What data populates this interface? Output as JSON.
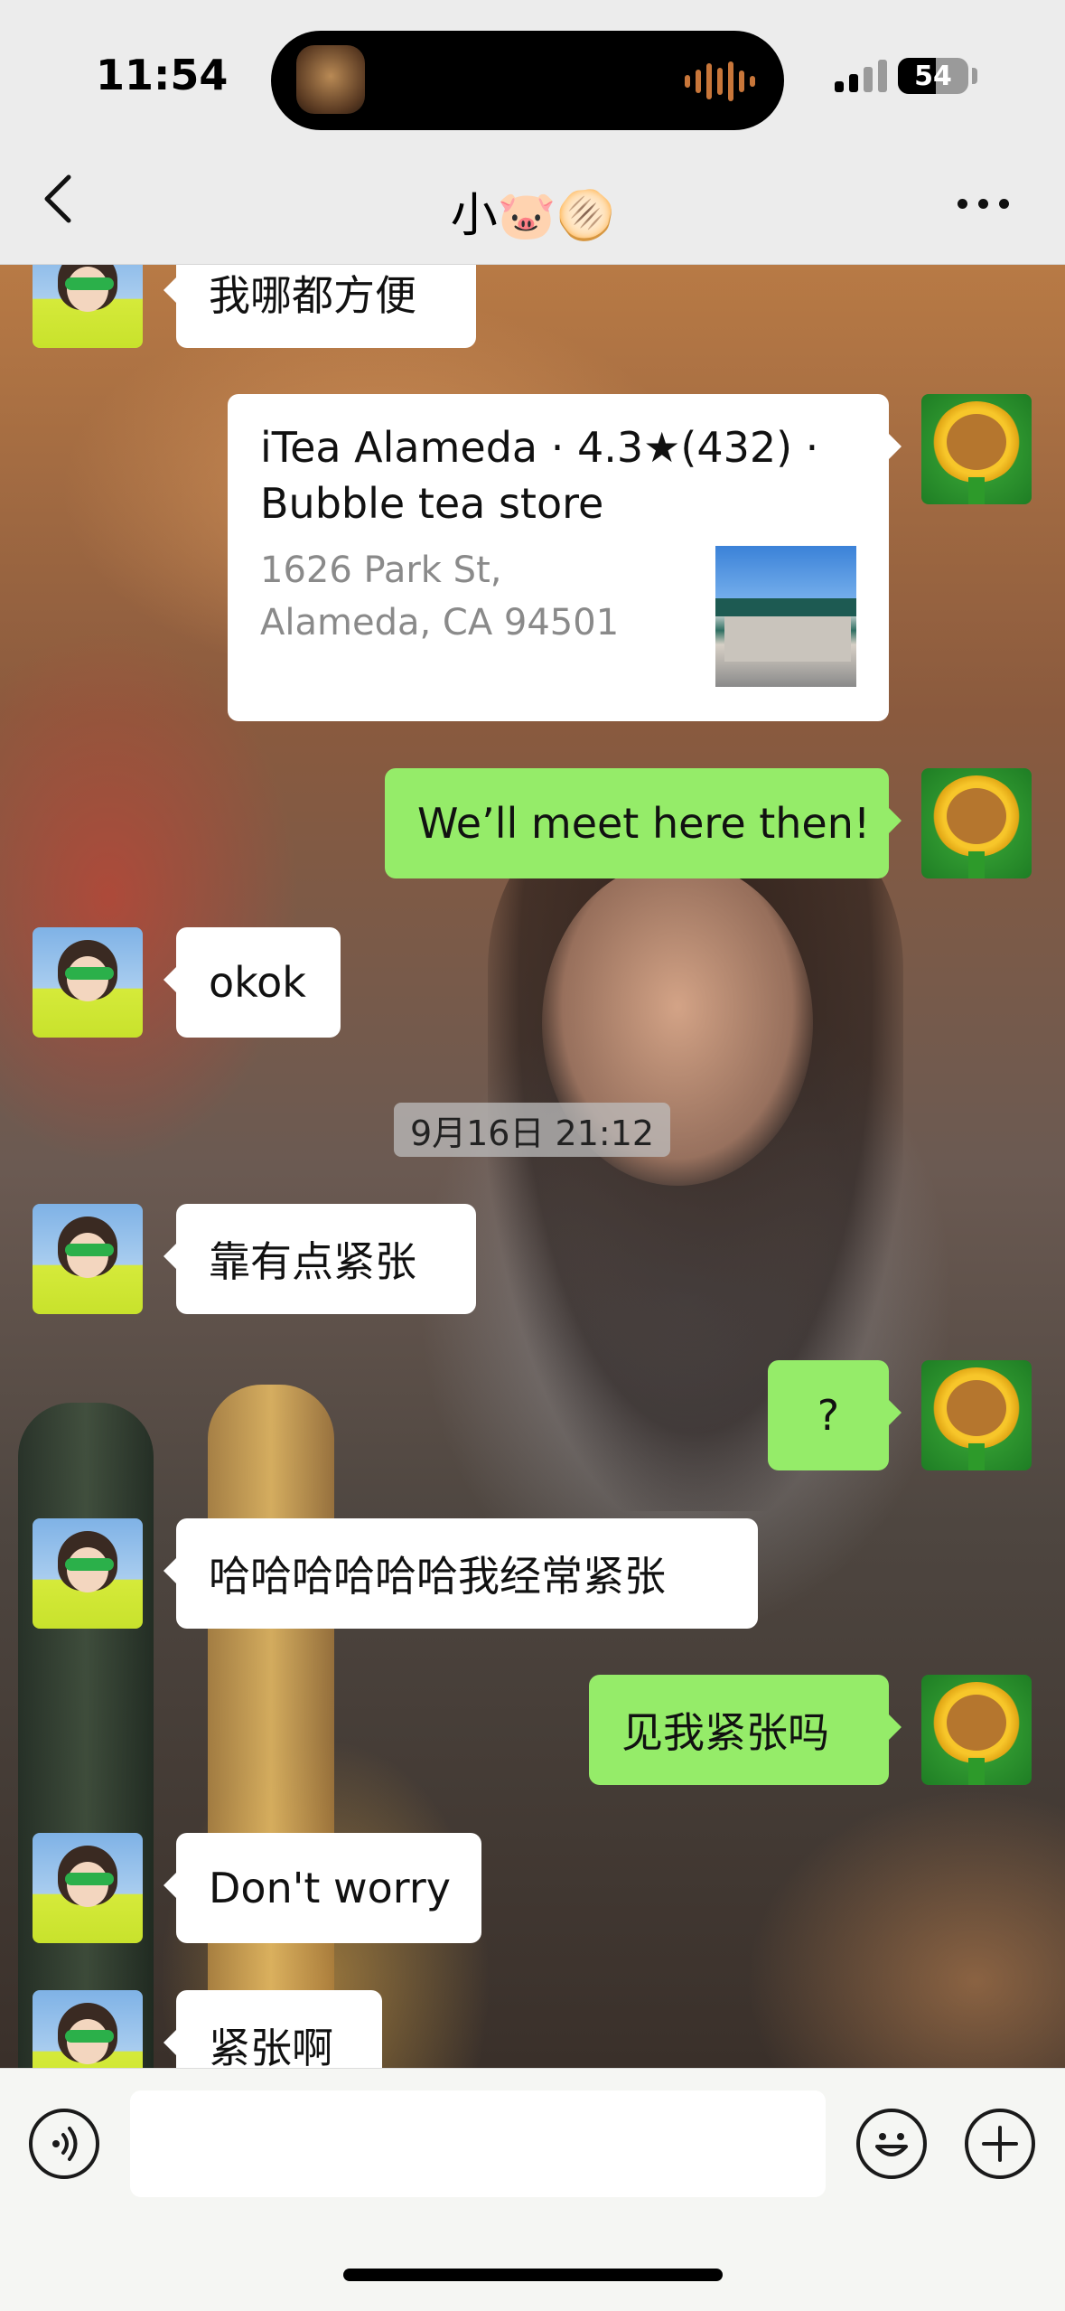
{
  "status_bar": {
    "time": "11:54",
    "battery": "54",
    "battery_level": 0.54
  },
  "header": {
    "title": "小🐷🫓"
  },
  "location_card": {
    "title": "iTea Alameda · 4.3★(432) · Bubble tea store",
    "address": "1626 Park St, Alameda, CA 94501"
  },
  "timestamp": "9月16日 21:12",
  "messages": [
    {
      "from": "friend",
      "text": "我哪都方便"
    },
    {
      "from": "me",
      "text": "We’ll meet here then!"
    },
    {
      "from": "friend",
      "text": "okok"
    },
    {
      "from": "friend",
      "text": "靠有点紧张"
    },
    {
      "from": "me",
      "text": "?"
    },
    {
      "from": "friend",
      "text": "哈哈哈哈哈哈我经常紧张"
    },
    {
      "from": "me",
      "text": "见我紧张吗"
    },
    {
      "from": "friend",
      "text": "Don't worry"
    },
    {
      "from": "friend",
      "text": "紧张啊"
    }
  ],
  "input": {
    "value": "",
    "placeholder": ""
  },
  "icons": {
    "back": "chevron-left-icon",
    "more": "more-dots-icon",
    "voice": "voice-icon",
    "emoji": "emoji-icon",
    "plus": "plus-icon"
  },
  "colors": {
    "my_bubble": "#95ec69",
    "friend_bubble": "#ffffff",
    "nav_bg": "#ececec"
  }
}
